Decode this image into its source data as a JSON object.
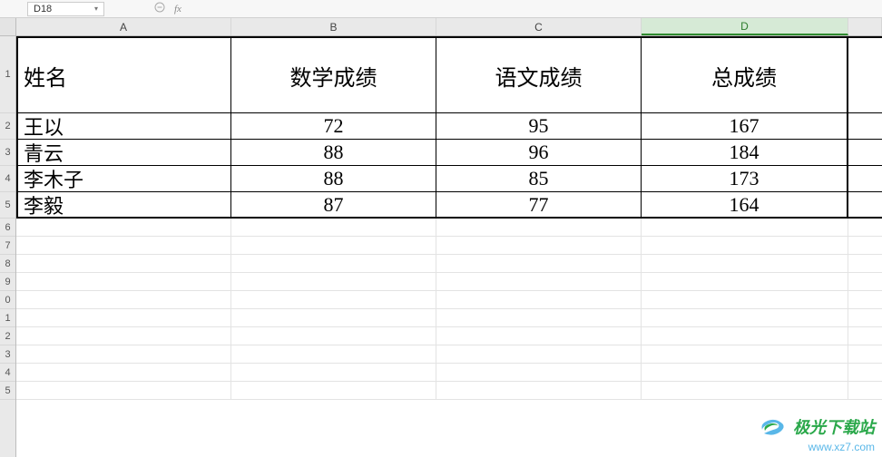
{
  "toolbar": {
    "cell_reference": "D18",
    "fx_label": "fx"
  },
  "columns": [
    "A",
    "B",
    "C",
    "D"
  ],
  "active_column": "D",
  "header_row_height": 85,
  "row_heights": {
    "data": 29,
    "empty": 20
  },
  "col_widths": {
    "A": 237,
    "B": 226,
    "C": 226,
    "D": 228
  },
  "row_labels": [
    "1",
    "2",
    "3",
    "4",
    "5",
    "6",
    "7",
    "8",
    "9",
    "0",
    "1",
    "2",
    "3",
    "4",
    "5"
  ],
  "table": {
    "headers": [
      "姓名",
      "数学成绩",
      "语文成绩",
      "总成绩"
    ],
    "rows": [
      {
        "name": "王以",
        "math": 72,
        "chinese": 95,
        "total": 167
      },
      {
        "name": "青云",
        "math": 88,
        "chinese": 96,
        "total": 184
      },
      {
        "name": "李木子",
        "math": 88,
        "chinese": 85,
        "total": 173
      },
      {
        "name": "李毅",
        "math": 87,
        "chinese": 77,
        "total": 164
      }
    ]
  },
  "watermark": {
    "line1": "极光下载站",
    "line2": "www.xz7.com"
  },
  "chart_data": {
    "type": "table",
    "columns": [
      "姓名",
      "数学成绩",
      "语文成绩",
      "总成绩"
    ],
    "rows": [
      [
        "王以",
        72,
        95,
        167
      ],
      [
        "青云",
        88,
        96,
        184
      ],
      [
        "李木子",
        88,
        85,
        173
      ],
      [
        "李毅",
        87,
        77,
        164
      ]
    ]
  }
}
